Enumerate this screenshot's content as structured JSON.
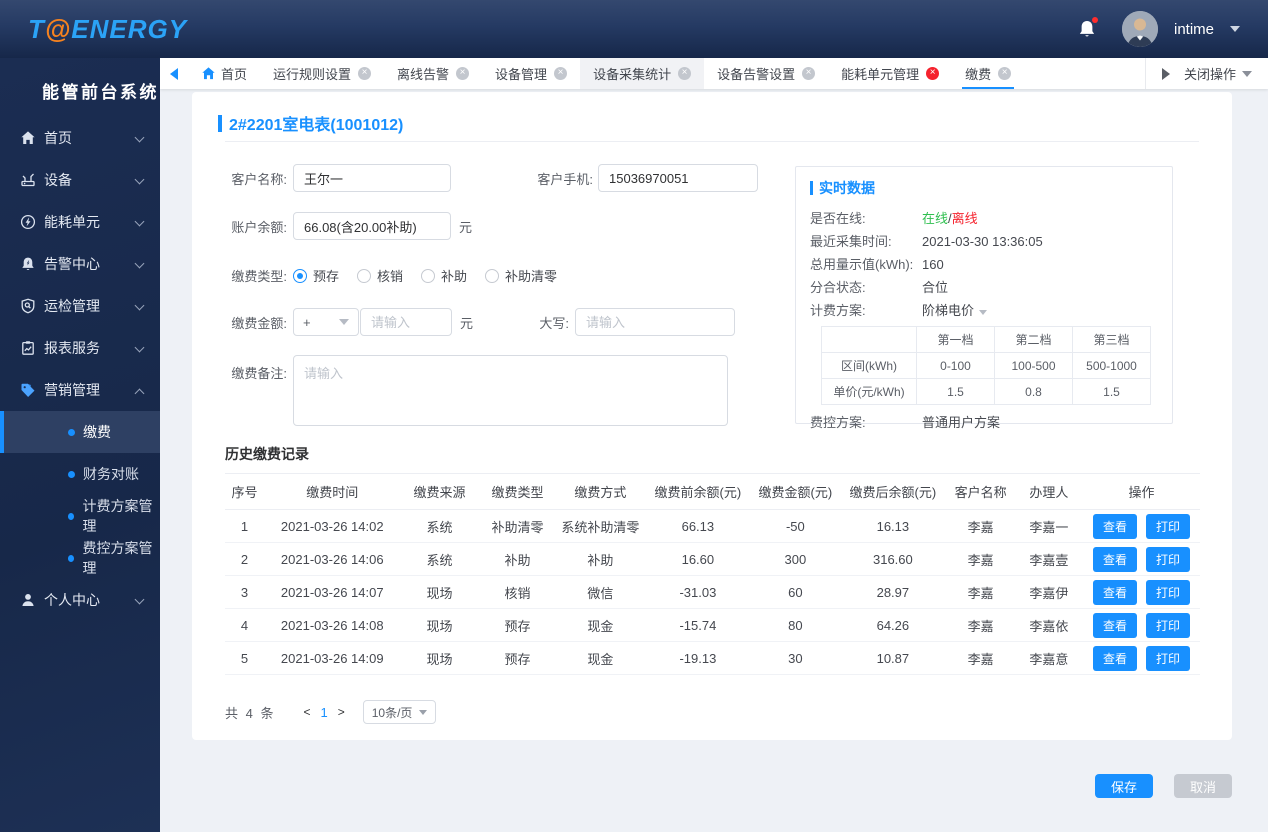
{
  "colors": {
    "accent": "#1890ff",
    "online_green": "#2fbf4f",
    "offline_red": "#f5222d"
  },
  "header": {
    "logo_part1": "T",
    "logo_accent": "@",
    "logo_part2": "ENERGY",
    "user_name": "intime"
  },
  "sidebar": {
    "title": "能管前台系统",
    "items": [
      {
        "label": "首页",
        "icon": "home"
      },
      {
        "label": "设备",
        "icon": "device"
      },
      {
        "label": "能耗单元",
        "icon": "energy"
      },
      {
        "label": "告警中心",
        "icon": "alarm"
      },
      {
        "label": "运检管理",
        "icon": "shield-inspect"
      },
      {
        "label": "报表服务",
        "icon": "report"
      },
      {
        "label": "营销管理",
        "icon": "marketing-tag",
        "expanded": true
      },
      {
        "label": "个人中心",
        "icon": "user"
      }
    ],
    "submenu": [
      "缴费",
      "财务对账",
      "计费方案管理",
      "费控方案管理"
    ],
    "active_submenu": "缴费"
  },
  "tabbar": {
    "tabs": [
      {
        "label": "首页",
        "closable": false
      },
      {
        "label": "运行规则设置",
        "closable": true
      },
      {
        "label": "离线告警",
        "closable": true
      },
      {
        "label": "设备管理",
        "closable": true
      },
      {
        "label": "设备采集统计",
        "closable": true
      },
      {
        "label": "设备告警设置",
        "closable": true
      },
      {
        "label": "能耗单元管理",
        "closable": true,
        "close_red": true
      },
      {
        "label": "缴费",
        "closable": true,
        "active": true
      }
    ],
    "close_menu_label": "关闭操作"
  },
  "page": {
    "title": "2#2201室电表(1001012)"
  },
  "form": {
    "customer_name_label": "客户名称:",
    "customer_name_value": "王尔一",
    "customer_phone_label": "客户手机:",
    "customer_phone_value": "15036970051",
    "balance_label": "账户余额:",
    "balance_value": "66.08(含20.00补助)",
    "balance_unit": "元",
    "pay_type_label": "缴费类型:",
    "pay_types": [
      "预存",
      "核销",
      "补助",
      "补助清零"
    ],
    "pay_type_selected": "预存",
    "amount_label": "缴费金额:",
    "amount_sign": "+",
    "amount_placeholder": "请输入",
    "amount_unit": "元",
    "caps_label": "大写:",
    "caps_placeholder": "请输入",
    "remark_label": "缴费备注:",
    "remark_placeholder": "请输入"
  },
  "realtime": {
    "title": "实时数据",
    "online_row_label": "是否在线:",
    "online_label": "在线",
    "online_sep": "/",
    "offline_label": "离线",
    "collect_time_label": "最近采集时间:",
    "collect_time": "2021-03-30 13:36:05",
    "total_label": "总用量示值(kWh):",
    "total_value": "160",
    "switch_label": "分合状态:",
    "switch_value": "合位",
    "plan_label": "计费方案:",
    "plan_value": "阶梯电价",
    "tier_table": {
      "headers": [
        "",
        "第一档",
        "第二档",
        "第三档"
      ],
      "rows": [
        {
          "label": "区间(kWh)",
          "values": [
            "0-100",
            "100-500",
            "500-1000"
          ]
        },
        {
          "label": "单价(元/kWh)",
          "values": [
            "1.5",
            "0.8",
            "1.5"
          ]
        }
      ]
    },
    "fee_plan_label": "费控方案:",
    "fee_plan_value": "普通用户方案"
  },
  "history": {
    "title": "历史缴费记录",
    "columns": [
      "序号",
      "缴费时间",
      "缴费来源",
      "缴费类型",
      "缴费方式",
      "缴费前余额(元)",
      "缴费金额(元)",
      "缴费后余额(元)",
      "客户名称",
      "办理人",
      "操作"
    ],
    "view_label": "查看",
    "print_label": "打印",
    "rows": [
      {
        "no": "1",
        "time": "2021-03-26 14:02",
        "source": "系统",
        "type": "补助清零",
        "method": "系统补助清零",
        "before": "66.13",
        "amount": "-50",
        "after": "16.13",
        "customer": "李嘉",
        "operator": "李嘉一"
      },
      {
        "no": "2",
        "time": "2021-03-26 14:06",
        "source": "系统",
        "type": "补助",
        "method": "补助",
        "before": "16.60",
        "amount": "300",
        "after": "316.60",
        "customer": "李嘉",
        "operator": "李嘉壹"
      },
      {
        "no": "3",
        "time": "2021-03-26 14:07",
        "source": "现场",
        "type": "核销",
        "method": "微信",
        "before": "-31.03",
        "amount": "60",
        "after": "28.97",
        "customer": "李嘉",
        "operator": "李嘉伊"
      },
      {
        "no": "4",
        "time": "2021-03-26 14:08",
        "source": "现场",
        "type": "预存",
        "method": "现金",
        "before": "-15.74",
        "amount": "80",
        "after": "64.26",
        "customer": "李嘉",
        "operator": "李嘉依"
      },
      {
        "no": "5",
        "time": "2021-03-26 14:09",
        "source": "现场",
        "type": "预存",
        "method": "现金",
        "before": "-19.13",
        "amount": "30",
        "after": "10.87",
        "customer": "李嘉",
        "operator": "李嘉意"
      }
    ],
    "pagination": {
      "total_text": "共 4 条",
      "prev": "<",
      "page": "1",
      "next": ">",
      "page_size": "10条/页"
    }
  },
  "footer": {
    "save_label": "保存",
    "cancel_label": "取消"
  }
}
